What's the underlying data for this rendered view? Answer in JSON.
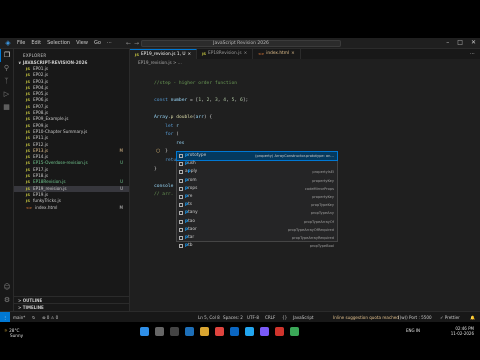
{
  "titlebar": {
    "menu": [
      "File",
      "Edit",
      "Selection",
      "View",
      "Go",
      "···"
    ],
    "search": "JavaScript Revision 2026"
  },
  "explorer": {
    "header": "EXPLORER",
    "folder": "∨ JAVASCRIPT-REVISION-2026",
    "files": [
      {
        "name": "EP01.js",
        "type": "js",
        "status": "",
        "badge": ""
      },
      {
        "name": "EP02.js",
        "type": "js",
        "status": "",
        "badge": ""
      },
      {
        "name": "EP03.js",
        "type": "js",
        "status": "",
        "badge": ""
      },
      {
        "name": "EP04.js",
        "type": "js",
        "status": "",
        "badge": ""
      },
      {
        "name": "EP05.js",
        "type": "js",
        "status": "",
        "badge": ""
      },
      {
        "name": "EP06.js",
        "type": "js",
        "status": "",
        "badge": ""
      },
      {
        "name": "EP07.js",
        "type": "js",
        "status": "",
        "badge": ""
      },
      {
        "name": "EP08.js",
        "type": "js",
        "status": "",
        "badge": ""
      },
      {
        "name": "EP09_Example.js",
        "type": "js",
        "status": "",
        "badge": ""
      },
      {
        "name": "EP09.js",
        "type": "js",
        "status": "",
        "badge": ""
      },
      {
        "name": "EP10-Chapter Summary.js",
        "type": "js",
        "status": "",
        "badge": ""
      },
      {
        "name": "EP11.js",
        "type": "js",
        "status": "",
        "badge": ""
      },
      {
        "name": "EP12.js",
        "type": "js",
        "status": "",
        "badge": ""
      },
      {
        "name": "EP13.js",
        "type": "js",
        "status": "mod",
        "badge": "M"
      },
      {
        "name": "EP14.js",
        "type": "js",
        "status": "",
        "badge": ""
      },
      {
        "name": "EP15-Overdose-revision.js",
        "type": "js",
        "status": "unt",
        "badge": "U"
      },
      {
        "name": "EP17.js",
        "type": "js",
        "status": "",
        "badge": ""
      },
      {
        "name": "EP18.js",
        "type": "js",
        "status": "",
        "badge": ""
      },
      {
        "name": "EP18Revision.js",
        "type": "js",
        "status": "unt",
        "badge": "U"
      },
      {
        "name": "EP19_revision.js",
        "type": "js",
        "status": "sel",
        "badge": "U"
      },
      {
        "name": "EP19.js",
        "type": "js",
        "status": "",
        "badge": ""
      },
      {
        "name": "funkyTricks.js",
        "type": "js",
        "status": "",
        "badge": ""
      },
      {
        "name": "index.html",
        "type": "html",
        "status": "",
        "badge": "M"
      }
    ],
    "outline": "> OUTLINE",
    "timeline": "> TIMELINE"
  },
  "tabs": [
    {
      "label": "EP19_revision.js 1, U",
      "type": "js",
      "state": "active"
    },
    {
      "label": "EP18Revision.js",
      "type": "js",
      "state": ""
    },
    {
      "label": "index.html",
      "type": "html",
      "state": "mod"
    }
  ],
  "breadcrumb": "EP19_revision.js > ...",
  "code_lines": [
    {
      "html": ""
    },
    {
      "html": "<span class='cm'>//step - higher order function</span>"
    },
    {
      "html": ""
    },
    {
      "html": "<span class='kw'>const</span> <span class='vr'>number</span> = [<span class='nm'>1</span>, <span class='nm'>2</span>, <span class='nm'>3</span>, <span class='nm'>4</span>, <span class='nm'>5</span>, <span class='nm'>6</span>];"
    },
    {
      "html": ""
    },
    {
      "html": "<span class='vr'>Array</span>.<span class='fn'>p</span> <span class='fn'>double</span>(<span class='vr'>arr</span>) {"
    },
    {
      "html": "    <span class='kw'>let</span> <span class='vr'>r</span>"
    },
    {
      "html": "    <span class='kw'>for</span> ("
    },
    {
      "html": "        <span class='vr'>res</span>"
    },
    {
      "html": "    }"
    },
    {
      "html": "    <span class='kw'>retur</span>"
    },
    {
      "html": "}"
    },
    {
      "html": ""
    },
    {
      "html": "<span class='vr'>console</span>"
    },
    {
      "html": "<span class='cm'>// arr.</span>"
    }
  ],
  "suggestions": [
    {
      "pre": "",
      "match": "p",
      "rest": "rototype",
      "detail": "(property) ArrayConstructor.prototype: an…",
      "selected": true
    },
    {
      "pre": "",
      "match": "p",
      "rest": "ush",
      "detail": "",
      "selected": false
    },
    {
      "pre": "a",
      "match": "p",
      "rest": "ply",
      "detail": "propertyIsEl",
      "selected": false
    },
    {
      "pre": "",
      "match": "p",
      "rest": "rom",
      "detail": "propertyKey",
      "selected": false
    },
    {
      "pre": "",
      "match": "p",
      "rest": "rops",
      "detail": "codeMirrorProps",
      "selected": false
    },
    {
      "pre": "",
      "match": "p",
      "rest": "re",
      "detail": "propertyKey",
      "selected": false
    },
    {
      "pre": "",
      "match": "p",
      "rest": "ts",
      "detail": "propTypeKey",
      "selected": false
    },
    {
      "pre": "",
      "match": "p",
      "rest": "tany",
      "detail": "propTypeAny",
      "selected": false
    },
    {
      "pre": "",
      "match": "p",
      "rest": "tao",
      "detail": "propTypeArrayOf",
      "selected": false
    },
    {
      "pre": "",
      "match": "p",
      "rest": "taor",
      "detail": "propTypeArrayOfRequired",
      "selected": false
    },
    {
      "pre": "",
      "match": "p",
      "rest": "tar",
      "detail": "propTypeArrayRequired",
      "selected": false
    },
    {
      "pre": "",
      "match": "p",
      "rest": "tb",
      "detail": "propTypeBool",
      "selected": false
    }
  ],
  "status": {
    "left": "main*",
    "sync": "↻",
    "errors": "⊗ 0 ⚠ 0",
    "position": "Ln 5, Col 8",
    "spaces": "Spaces: 2",
    "encoding": "UTF-8",
    "eol": "CRLF",
    "braces": "{}",
    "language": "JavaScript",
    "copilot": "Inline suggestion quota reached",
    "golive": "((ᴡ)) Port : 5500",
    "prettier": "✓ Prettier",
    "bell": "🔔"
  },
  "taskbar": {
    "temp": "28°C",
    "weather": "Sunny",
    "lang": "ENG IN",
    "time": "02:46 PM",
    "date": "11-02-2026"
  }
}
